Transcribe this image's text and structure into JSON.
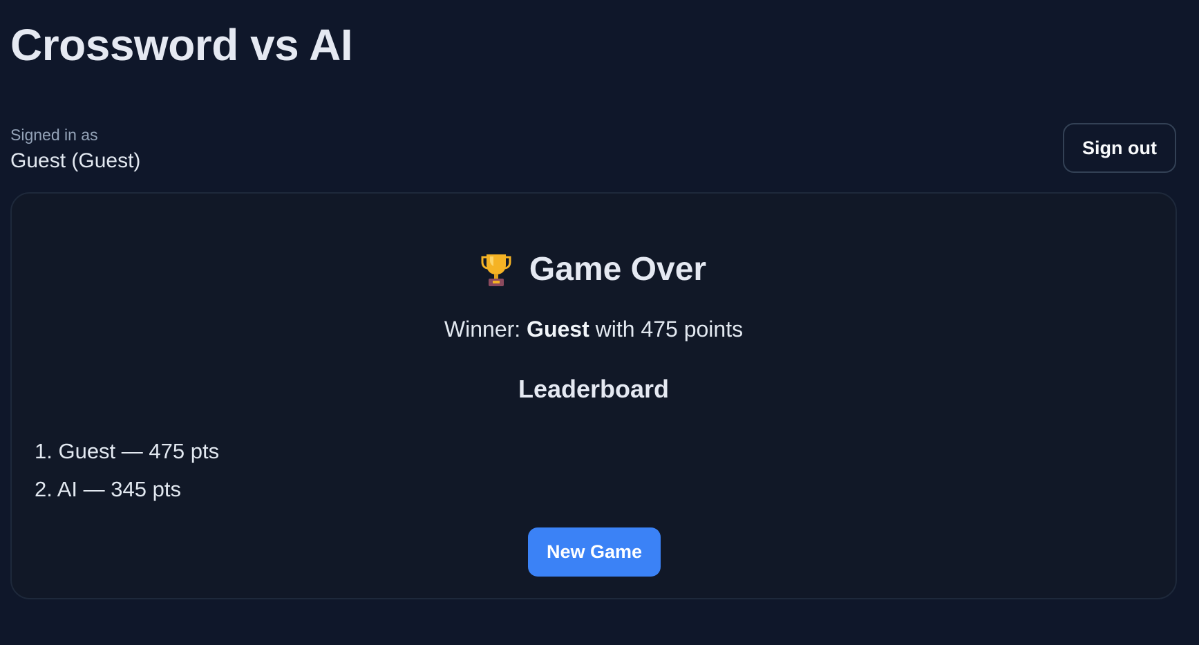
{
  "app": {
    "title": "Crossword vs AI"
  },
  "user": {
    "signed_in_label": "Signed in as",
    "name": "Guest (Guest)",
    "sign_out_label": "Sign out"
  },
  "result": {
    "heading": "Game Over",
    "heading_icon": "trophy-icon",
    "winner_prefix": "Winner: ",
    "winner_name": "Guest",
    "winner_suffix": " with 475 points"
  },
  "leaderboard": {
    "title": "Leaderboard",
    "entries": [
      "1. Guest — 475 pts",
      "2. AI — 345 pts"
    ]
  },
  "actions": {
    "new_game_label": "New Game"
  },
  "colors": {
    "background": "#0f172a",
    "card": "#111827",
    "accent": "#3b82f6"
  }
}
